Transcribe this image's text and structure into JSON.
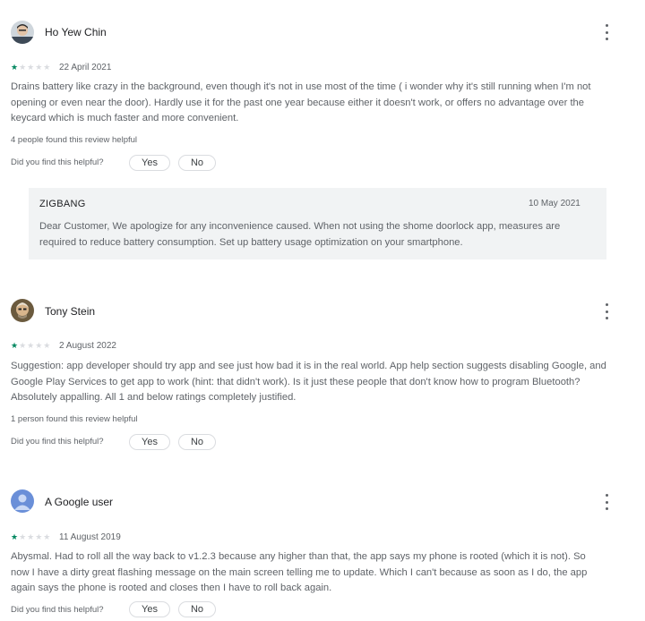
{
  "helpful_prompt": "Did you find this helpful?",
  "yes_label": "Yes",
  "no_label": "No",
  "colors": {
    "star_active": "#01875f",
    "star_inactive": "#dadce0",
    "reply_bg": "#f1f3f4"
  },
  "reviews": [
    {
      "author": "Ho Yew Chin",
      "rating": 1,
      "date": "22 April 2021",
      "text": "Drains battery like crazy in the background, even though it's not in use most of the time ( i wonder why it's still running when I'm not opening or even near the door). Hardly use it for the past one year because either it doesn't work, or offers no advantage over the keycard which is much faster and more convenient.",
      "helpful_count": "4 people found this review helpful",
      "reply": {
        "author": "ZIGBANG",
        "date": "10 May 2021",
        "text": "Dear Customer, We apologize for any inconvenience caused. When not using the shome doorlock app, measures are required to reduce battery consumption. Set up battery usage optimization on your smartphone."
      }
    },
    {
      "author": "Tony Stein",
      "rating": 1,
      "date": "2 August 2022",
      "text": "Suggestion: app developer should try app and see just how bad it is in the real world. App help section suggests disabling Google, and Google Play Services to get app to work (hint: that didn't work). Is it just these people that don't know how to program Bluetooth? Absolutely appalling. All 1 and below ratings completely justified.",
      "helpful_count": "1 person found this review helpful"
    },
    {
      "author": "A Google user",
      "rating": 1,
      "date": "11 August 2019",
      "text": "Abysmal. Had to roll all the way back to v1.2.3 because any higher than that, the app says my phone is rooted (which it is not). So now I have a dirty great flashing message on the main screen telling me to update. Which I can't because as soon as I do, the app again says the phone is rooted and closes then I have to roll back again."
    }
  ]
}
